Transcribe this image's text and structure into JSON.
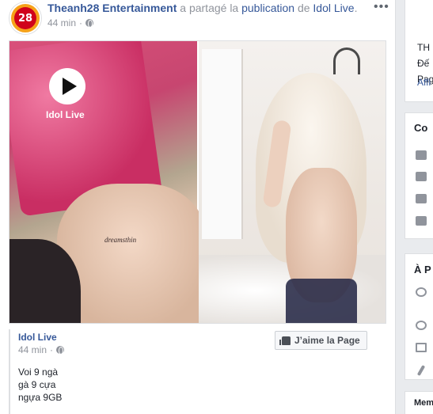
{
  "post": {
    "author": "Theanh28 Entertainment",
    "shared_text": "a partagé la",
    "publication": "publication",
    "de": "de",
    "source": "Idol Live",
    "period": ".",
    "time": "44 min",
    "more": "•••",
    "avatar_text": "28"
  },
  "shared_image": {
    "logo_text": "Idol Live",
    "tattoo_text": "dreamsthin"
  },
  "attribution": {
    "name": "Idol Live",
    "time": "44 min",
    "like_page_label": "J’aime la Page",
    "text_lines": [
      "Voi 9 ngà",
      "gà 9 cựa",
      "ngựa 9GB"
    ]
  },
  "right_column": {
    "card1": [
      "TH",
      "Đế",
      "Pag",
      "Affi"
    ],
    "card2_title": "Co",
    "card3_title": "À P",
    "card4_title": "Mem"
  }
}
